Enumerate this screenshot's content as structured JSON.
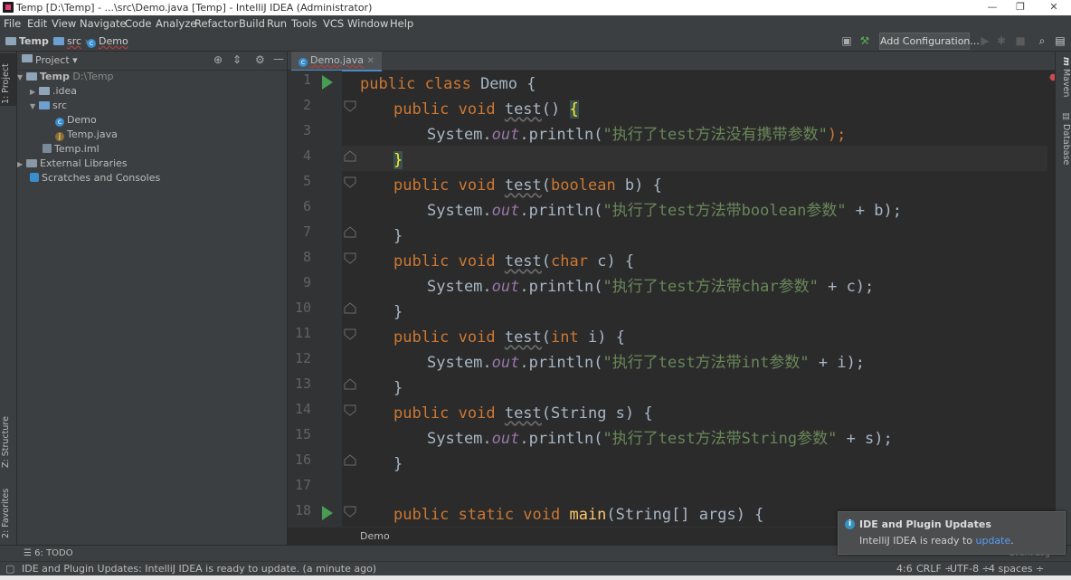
{
  "titlebar": {
    "title": "Temp [D:\\Temp] - ...\\src\\Demo.java [Temp] - IntelliJ IDEA (Administrator)",
    "minimize": "—",
    "restore": "❐",
    "close": "✕"
  },
  "menu": [
    "File",
    "Edit",
    "View",
    "Navigate",
    "Code",
    "Analyze",
    "Refactor",
    "Build",
    "Run",
    "Tools",
    "VCS",
    "Window",
    "Help"
  ],
  "navbar": {
    "crumbs": [
      "Temp",
      "src",
      "Demo"
    ],
    "add_configuration": "Add Configuration..."
  },
  "left_stripe": {
    "project_tab": "1: Project",
    "structure_tab": "Z: Structure",
    "favorites_tab": "2: Favorites"
  },
  "project_panel": {
    "header": "Project",
    "tree": [
      {
        "label": "Temp",
        "extra": "D:\\Temp"
      },
      {
        "label": ".idea"
      },
      {
        "label": "src"
      },
      {
        "label": "Demo"
      },
      {
        "label": "Temp.java"
      },
      {
        "label": "Temp.iml"
      },
      {
        "label": "External Libraries"
      },
      {
        "label": "Scratches and Consoles"
      }
    ]
  },
  "editor": {
    "tab": "Demo.java",
    "line_numbers": [
      "1",
      "2",
      "3",
      "4",
      "5",
      "6",
      "7",
      "8",
      "9",
      "10",
      "11",
      "12",
      "13",
      "14",
      "15",
      "16",
      "17",
      "18"
    ],
    "breadcrumb": "Demo",
    "lines": [
      [
        "public class ",
        "Demo {"
      ],
      [
        "public void ",
        "test",
        "() ",
        "{"
      ],
      [
        "System.",
        "out",
        ".println(",
        "\"执行了test方法没有携带参数\"",
        ");"
      ],
      [
        "}"
      ],
      [
        "public void ",
        "test",
        "(",
        "boolean",
        " b) {"
      ],
      [
        "System.",
        "out",
        ".println(",
        "\"执行了test方法带boolean参数\"",
        " + b);"
      ],
      [
        "}"
      ],
      [
        "public void ",
        "test",
        "(",
        "char",
        " c) {"
      ],
      [
        "System.",
        "out",
        ".println(",
        "\"执行了test方法带char参数\"",
        " + c);"
      ],
      [
        "}"
      ],
      [
        "public void ",
        "test",
        "(",
        "int",
        " i) {"
      ],
      [
        "System.",
        "out",
        ".println(",
        "\"执行了test方法带int参数\"",
        " + i);"
      ],
      [
        "}"
      ],
      [
        "public void ",
        "test",
        "(String s) {"
      ],
      [
        "System.",
        "out",
        ".println(",
        "\"执行了test方法带String参数\"",
        " + s);"
      ],
      [
        "}"
      ],
      [
        ""
      ],
      [
        "public static void ",
        "main",
        "(String[] args) {"
      ]
    ]
  },
  "right_stripe": {
    "maven_tab": "Maven",
    "database_tab": "Database"
  },
  "bottom": {
    "todo": "6: TODO",
    "event_log": "Event Log"
  },
  "status": {
    "message": "IDE and Plugin Updates: IntelliJ IDEA is ready to update. (a minute ago)",
    "position": "4:6",
    "line_sep": "CRLF ÷",
    "encoding": "UTF-8 ÷",
    "indent": "4 spaces ÷"
  },
  "notification": {
    "title": "IDE and Plugin Updates",
    "text": "IntelliJ IDEA is ready to",
    "link": "update",
    "tail": "."
  },
  "colors": {
    "keyword": "#cc7832",
    "string": "#6a8759",
    "static_field": "#9876aa",
    "method_decl": "#ffc66d",
    "run_icon": "#499c54"
  }
}
